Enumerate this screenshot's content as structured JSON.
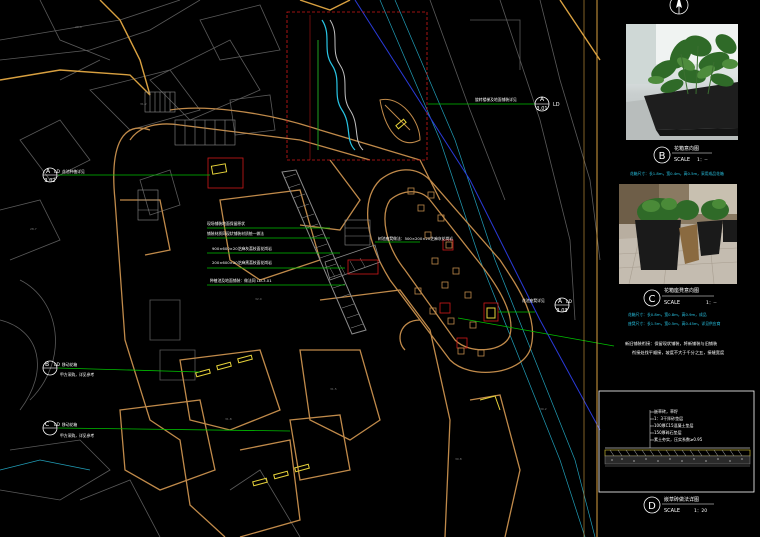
{
  "callouts": {
    "a_top": {
      "letter": "A",
      "code": "LD",
      "sheet": "3.01",
      "note": "旋转楼梯及地面铺装详见"
    },
    "a_left": {
      "letter": "A",
      "code": "LD",
      "sheet": "3.02",
      "note": "花池种植详见"
    },
    "a_right": {
      "letter": "A",
      "code": "LD",
      "sheet": "3.03",
      "note": "花池座凳详见"
    },
    "b_left": {
      "letter": "B",
      "code": "LD",
      "note1": "移动花箱",
      "note2": "甲方采购，详见参考"
    },
    "c_left": {
      "letter": "C",
      "code": "LD",
      "note1": "移动花箱",
      "note2": "甲方采购，详见参考"
    }
  },
  "plan_notes": {
    "paving_1": "现场铺装地面保留原状",
    "paving_2": "铺装材质同现状铺装材质统一做法",
    "paving_3": "900×600×20芝麻灰荔枝面花岗岩",
    "paving_4": "200×600×20芝麻黑荔枝面花岗岩",
    "paving_5": "种植池及地面铺装：做法同 LD-3.01",
    "bench_1": "树池座凳做法：500×200×20芝麻灰花岗岩",
    "long_note_1": "新旧铺装衔接：保留现状铺装，将新铺装与旧铺装",
    "long_note_2": "衔接处找平顺接，坡度不大于千分之五，接缝宽度"
  },
  "panels": {
    "b": {
      "letter": "B",
      "title": "花箱意向图",
      "scale_label": "SCALE",
      "scale_value": "1：--",
      "note": "花箱尺寸：长1.8m，宽0.4m，高0.5m，采用成品花箱"
    },
    "c": {
      "letter": "C",
      "title": "花箱座凳意向图",
      "scale_label": "SCALE",
      "scale_value": "1：--",
      "note1": "花箱尺寸：长0.8m，宽0.8m，高0.9m，成品",
      "note2": "座凳尺寸：长1.5m，宽0.5m，高0.45m，详见供应商"
    },
    "d": {
      "letter": "D",
      "title": "嵌草砖做法详图",
      "scale_label": "SCALE",
      "scale_value": "1：20",
      "layers": [
        "嵌草砖，草籽",
        "1：3干拌砂垫层",
        "100厚C15混凝土垫层",
        "150厚碎石垫层",
        "素土夯实，压实系数≥0.95"
      ]
    }
  },
  "colors": {
    "background": "#000000",
    "outline": "#c08a4a",
    "callout_green": "#00c000",
    "red_box": "#d01818",
    "cyan": "#29c6e6",
    "yellow": "#e6d23a",
    "grey": "#8a8a8a"
  },
  "icons": [
    "north-arrow-icon"
  ]
}
